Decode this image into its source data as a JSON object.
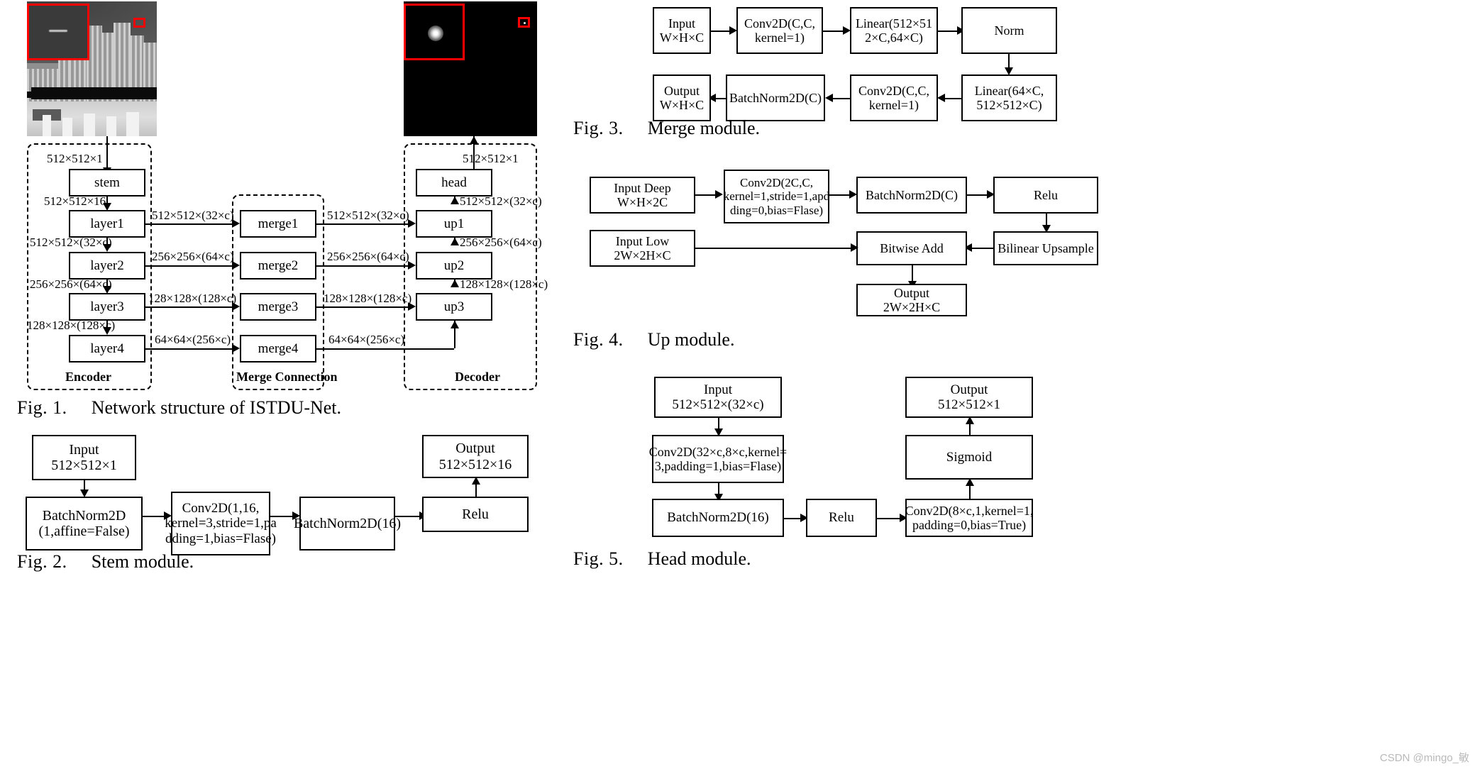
{
  "figure1": {
    "caption_num": "Fig. 1.",
    "caption_text": "Network structure of ISTDU-Net.",
    "groups": {
      "encoder": "Encoder",
      "merge": "Merge Connection",
      "decoder": "Decoder"
    },
    "encoder_blocks": [
      "stem",
      "layer1",
      "layer2",
      "layer3",
      "layer4"
    ],
    "merge_blocks": [
      "merge1",
      "merge2",
      "merge3",
      "merge4"
    ],
    "decoder_blocks": [
      "head",
      "up1",
      "up2",
      "up3"
    ],
    "input_label": "512×512×1",
    "output_label": "512×512×1",
    "encoder_chain_labels": [
      "512×512×16",
      "512×512×(32×c)",
      "256×256×(64×c)",
      "128×128×(128×c)"
    ],
    "skip_labels": [
      "512×512×(32×c)",
      "256×256×(64×c)",
      "128×128×(128×c)",
      "64×64×(256×c)"
    ],
    "merge_out_labels": [
      "512×512×(32×c)",
      "256×256×(64×c)",
      "128×128×(128×c)",
      "64×64×(256×c)"
    ],
    "decoder_chain_labels": [
      "512×512×(32×c)",
      "256×256×(64×c)",
      "128×128×(128×c)"
    ]
  },
  "figure2": {
    "caption_num": "Fig. 2.",
    "caption_text": "Stem module.",
    "blocks": {
      "input": "Input\n512×512×1",
      "bn1": "BatchNorm2D\n(1,affine=False)",
      "conv": "Conv2D(1,16,\nkernel=3,stride=1,pa\ndding=1,bias=Flase)",
      "bn2": "BatchNorm2D(16)",
      "relu": "Relu",
      "output": "Output\n512×512×16"
    }
  },
  "figure3": {
    "caption_num": "Fig. 3.",
    "caption_text": "Merge module.",
    "blocks": {
      "input": "Input\nW×H×C",
      "conv1": "Conv2D(C,C,\nkernel=1)",
      "linear1": "Linear(512×51\n2×C,64×C)",
      "norm": "Norm",
      "linear2": "Linear(64×C,\n512×512×C)",
      "conv2": "Conv2D(C,C,\nkernel=1)",
      "bn": "BatchNorm2D(C)",
      "output": "Output\nW×H×C"
    }
  },
  "figure4": {
    "caption_num": "Fig. 4.",
    "caption_text": "Up module.",
    "blocks": {
      "input_deep": "Input Deep\nW×H×2C",
      "conv": "Conv2D(2C,C,\nkernel=1,stride=1,apd\nding=0,bias=Flase)",
      "bn": "BatchNorm2D(C)",
      "relu": "Relu",
      "input_low": "Input Low\n2W×2H×C",
      "bitwise_add": "Bitwise Add",
      "upsample": "Bilinear Upsample",
      "output": "Output\n2W×2H×C"
    }
  },
  "figure5": {
    "caption_num": "Fig. 5.",
    "caption_text": "Head module.",
    "blocks": {
      "input": "Input\n512×512×(32×c)",
      "conv1": "Conv2D(32×c,8×c,kernel=\n3,padding=1,bias=Flase)",
      "bn": "BatchNorm2D(16)",
      "relu": "Relu",
      "conv2": "Conv2D(8×c,1,kernel=1,\npadding=0,bias=True)",
      "sigmoid": "Sigmoid",
      "output": "Output\n512×512×1"
    }
  },
  "watermark": "CSDN @mingo_敏"
}
